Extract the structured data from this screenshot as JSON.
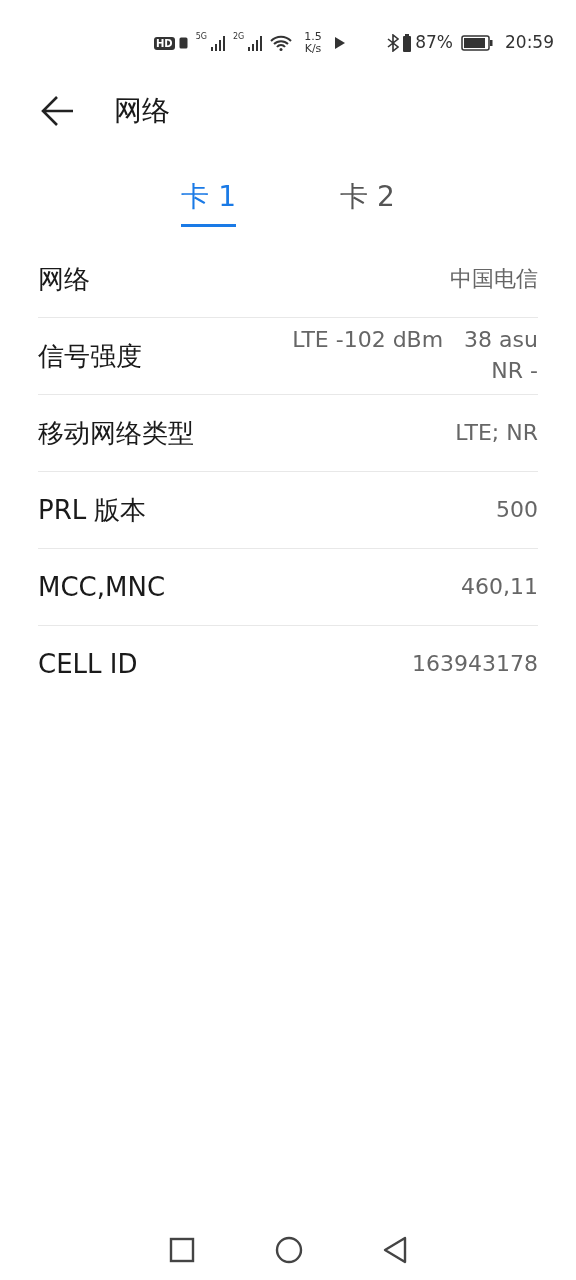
{
  "status_bar": {
    "hd": "HD",
    "networks": [
      "5G",
      "2G"
    ],
    "speed": [
      "1.5",
      "K/s"
    ],
    "battery": "87%",
    "time": "20:59"
  },
  "header": {
    "title": "网络"
  },
  "tabs": [
    {
      "label": "卡 1",
      "selected": true
    },
    {
      "label": "卡 2",
      "selected": false
    }
  ],
  "rows": [
    {
      "label": "网络",
      "value": [
        "中国电信"
      ]
    },
    {
      "label": "信号强度",
      "value": [
        "LTE -102 dBm   38 asu",
        "NR -"
      ]
    },
    {
      "label": "移动网络类型",
      "value": [
        "LTE; NR"
      ]
    },
    {
      "label": "PRL 版本",
      "value": [
        "500"
      ]
    },
    {
      "label": "MCC,MNC",
      "value": [
        "460,11"
      ]
    },
    {
      "label": "CELL ID",
      "value": [
        "163943178"
      ]
    }
  ]
}
